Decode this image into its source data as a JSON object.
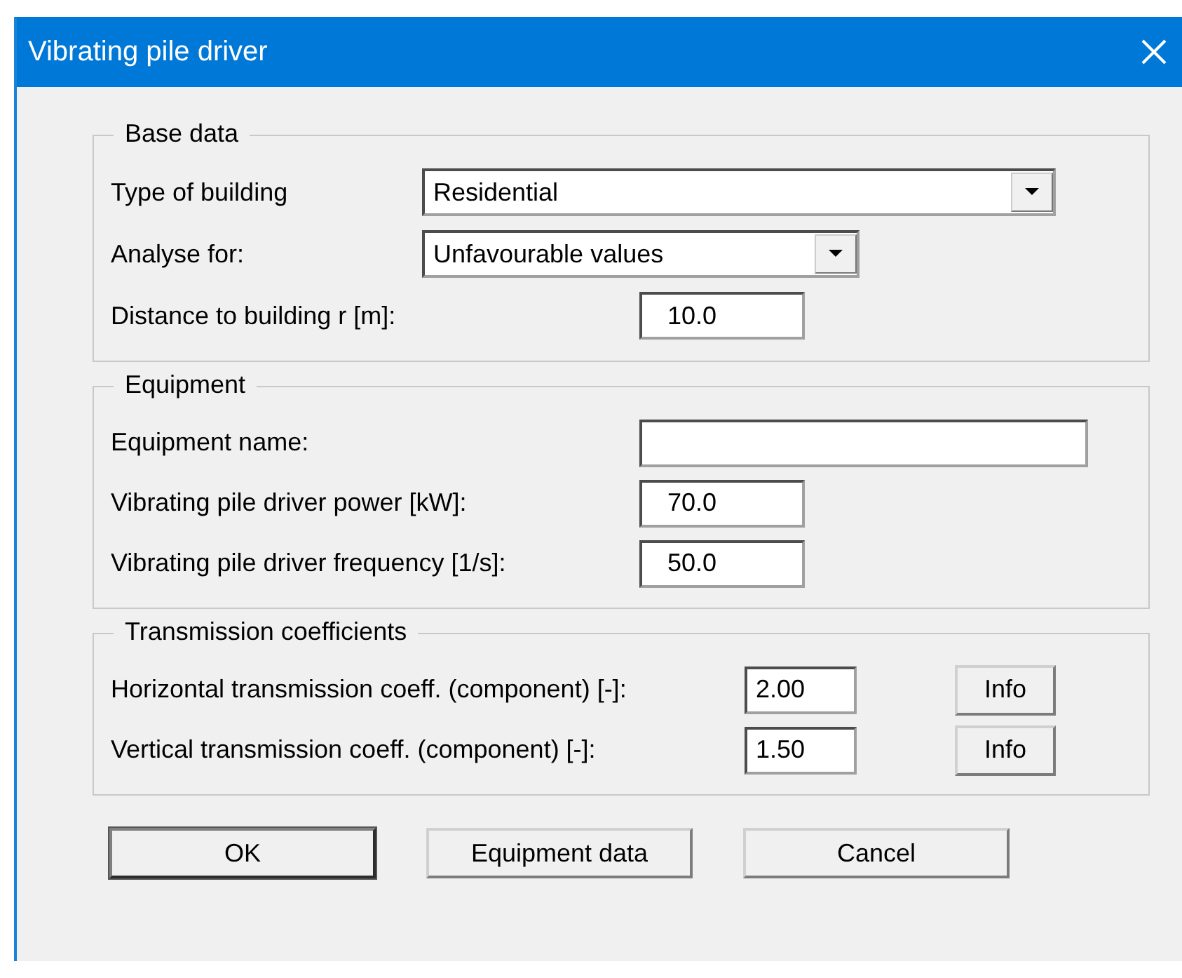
{
  "window": {
    "title": "Vibrating pile driver"
  },
  "groups": [
    {
      "title": "Base data",
      "rows": [
        {
          "kind": "combo",
          "label": "Type of building",
          "value": "Residential"
        },
        {
          "kind": "combo",
          "label": "Analyse for:",
          "value": "Unfavourable values"
        },
        {
          "kind": "field",
          "label": "Distance to building r [m]:",
          "value": "10.0"
        }
      ]
    },
    {
      "title": "Equipment",
      "rows": [
        {
          "kind": "field",
          "label": "Equipment name:",
          "value": ""
        },
        {
          "kind": "field",
          "label": "Vibrating pile driver power [kW]:",
          "value": "70.0"
        },
        {
          "kind": "field",
          "label": "Vibrating pile driver frequency [1/s]:",
          "value": "50.0"
        }
      ]
    },
    {
      "title": "Transmission coefficients",
      "rows": [
        {
          "kind": "info",
          "label": "Horizontal transmission coeff. (component) [-]:",
          "value": "2.00",
          "button": "Info"
        },
        {
          "kind": "info",
          "label": "Vertical transmission coeff. (component) [-]:",
          "value": "1.50",
          "button": "Info"
        }
      ]
    }
  ],
  "buttons": [
    {
      "label": "OK",
      "default": true
    },
    {
      "label": "Equipment data",
      "default": false
    },
    {
      "label": "Cancel",
      "default": false
    }
  ]
}
